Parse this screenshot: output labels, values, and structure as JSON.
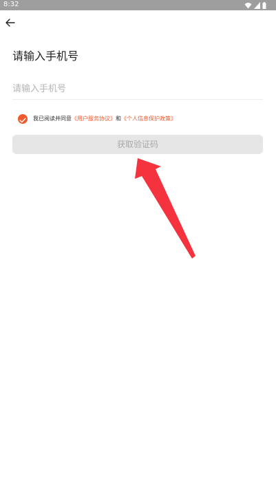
{
  "status_bar": {
    "time": "8:32"
  },
  "header": {
    "title": "请输入手机号"
  },
  "phone_input": {
    "value": "",
    "placeholder": "请输入手机号"
  },
  "agreement": {
    "checked": true,
    "prefix": "我已阅读并同意",
    "user_agreement": "《用户服务协议》",
    "conjunction": "和",
    "privacy_policy": "《个人信息保护政策》"
  },
  "primary_button": {
    "label": "获取验证码"
  },
  "colors": {
    "accent": "#f0592b",
    "button_disabled_bg": "#e6e6e6",
    "button_disabled_text": "#a9a9a9",
    "annotation_arrow": "#f5333f"
  },
  "icons": {
    "back": "arrow-left-icon",
    "checkbox": "check-circle-icon",
    "wifi": "wifi-icon",
    "signal": "signal-icon",
    "battery": "battery-icon"
  }
}
